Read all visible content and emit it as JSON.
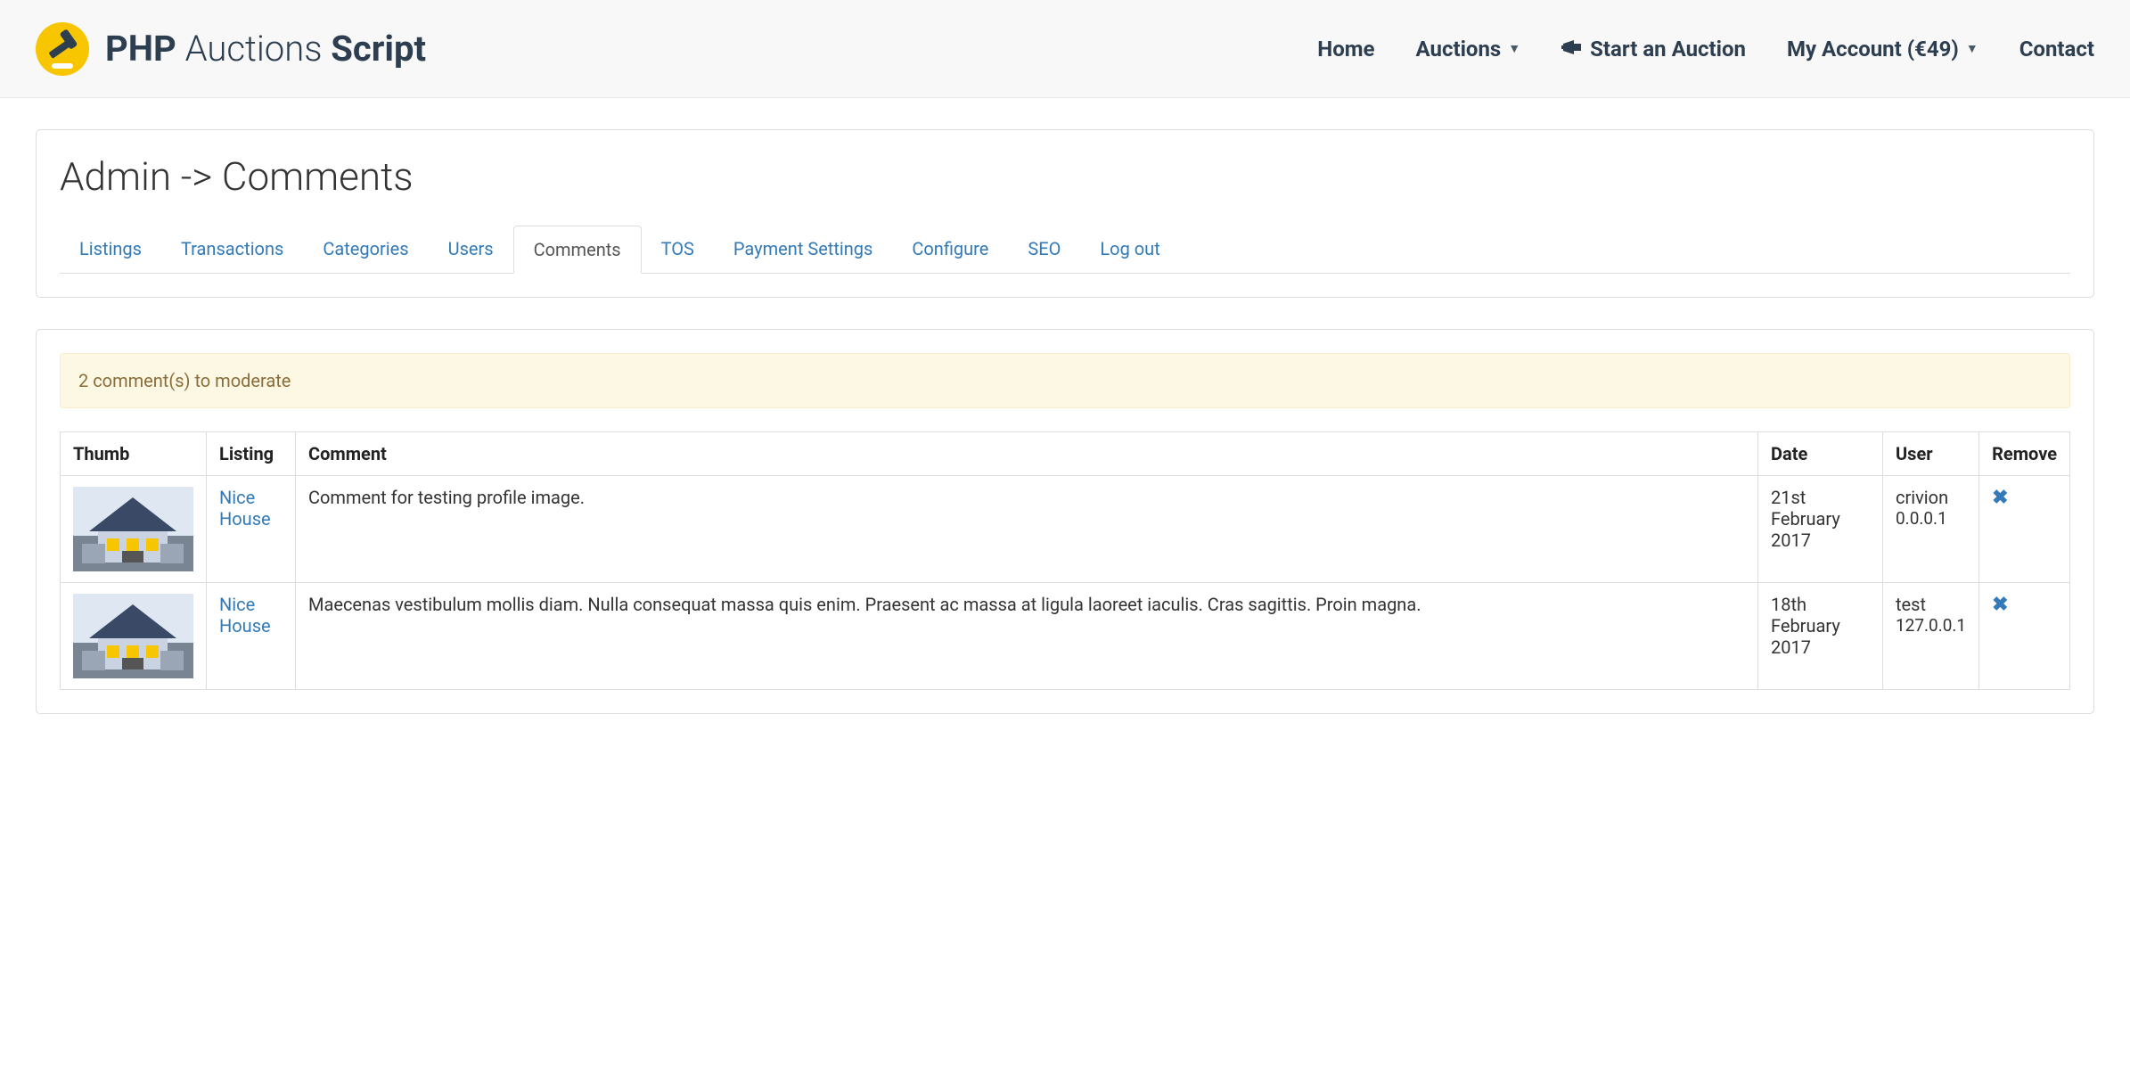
{
  "brand": {
    "word1": "PHP",
    "word2": "Auctions",
    "word3": "Script"
  },
  "nav": {
    "home": "Home",
    "auctions": "Auctions",
    "start": "Start an Auction",
    "account": "My Account (€49)",
    "contact": "Contact"
  },
  "page_title": "Admin -> Comments",
  "tabs": {
    "listings": "Listings",
    "transactions": "Transactions",
    "categories": "Categories",
    "users": "Users",
    "comments": "Comments",
    "tos": "TOS",
    "payment": "Payment Settings",
    "configure": "Configure",
    "seo": "SEO",
    "logout": "Log out"
  },
  "alert": "2 comment(s) to moderate",
  "table": {
    "headers": {
      "thumb": "Thumb",
      "listing": "Listing",
      "comment": "Comment",
      "date": "Date",
      "user": "User",
      "remove": "Remove"
    },
    "rows": [
      {
        "listing": "Nice House",
        "comment": "Comment for testing profile image.",
        "date": "21st February 2017",
        "user": "crivion",
        "ip": "0.0.0.1"
      },
      {
        "listing": "Nice House",
        "comment": "Maecenas vestibulum mollis diam. Nulla consequat massa quis enim. Praesent ac massa at ligula laoreet iaculis. Cras sagittis. Proin magna.",
        "date": "18th February 2017",
        "user": "test",
        "ip": "127.0.0.1"
      }
    ]
  }
}
